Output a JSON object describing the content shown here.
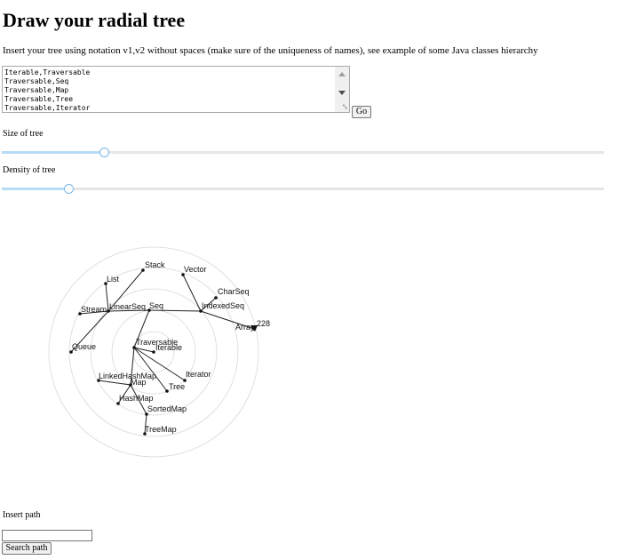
{
  "page": {
    "title": "Draw your radial tree",
    "intro": "Insert your tree using notation v1,v2 without spaces (make sure of the uniqueness of names), see example of some Java classes hierarchy"
  },
  "tree_input": {
    "value": "Iterable,Traversable\nTraversable,Seq\nTraversable,Map\nTraversable,Tree\nTraversable,Iterator\nSeq,IndexedSeq",
    "go_label": "Go"
  },
  "size_slider": {
    "label": "Size of tree",
    "value": 0.17
  },
  "density_slider": {
    "label": "Density of tree",
    "value": 0.11
  },
  "tree": {
    "nodes": [
      {
        "name": "Iterable"
      },
      {
        "name": "Traversable"
      },
      {
        "name": "Seq"
      },
      {
        "name": "Map"
      },
      {
        "name": "Tree"
      },
      {
        "name": "Iterator"
      },
      {
        "name": "LinearSeq"
      },
      {
        "name": "IndexedSeq"
      },
      {
        "name": "HashMap"
      },
      {
        "name": "LinkedHashMap"
      },
      {
        "name": "SortedMap"
      },
      {
        "name": "TreeMap"
      },
      {
        "name": "Stream"
      },
      {
        "name": "List"
      },
      {
        "name": "Queue"
      },
      {
        "name": "Stack"
      },
      {
        "name": "Vector"
      },
      {
        "name": "CharSeq"
      },
      {
        "name": "Array"
      }
    ],
    "edges": [
      [
        "Iterable",
        "Traversable"
      ],
      [
        "Traversable",
        "Seq"
      ],
      [
        "Traversable",
        "Map"
      ],
      [
        "Traversable",
        "Tree"
      ],
      [
        "Traversable",
        "Iterator"
      ],
      [
        "Seq",
        "LinearSeq"
      ],
      [
        "Seq",
        "IndexedSeq"
      ],
      [
        "Map",
        "HashMap"
      ],
      [
        "Map",
        "LinkedHashMap"
      ],
      [
        "Map",
        "SortedMap"
      ],
      [
        "SortedMap",
        "TreeMap"
      ],
      [
        "LinearSeq",
        "Stream"
      ],
      [
        "LinearSeq",
        "List"
      ],
      [
        "LinearSeq",
        "Queue"
      ],
      [
        "LinearSeq",
        "Stack"
      ],
      [
        "IndexedSeq",
        "Vector"
      ],
      [
        "IndexedSeq",
        "CharSeq"
      ],
      [
        "IndexedSeq",
        "Array"
      ]
    ],
    "extra_label": "228"
  },
  "path_search": {
    "label": "Insert path",
    "input_value": "",
    "button_label": "Search path"
  }
}
